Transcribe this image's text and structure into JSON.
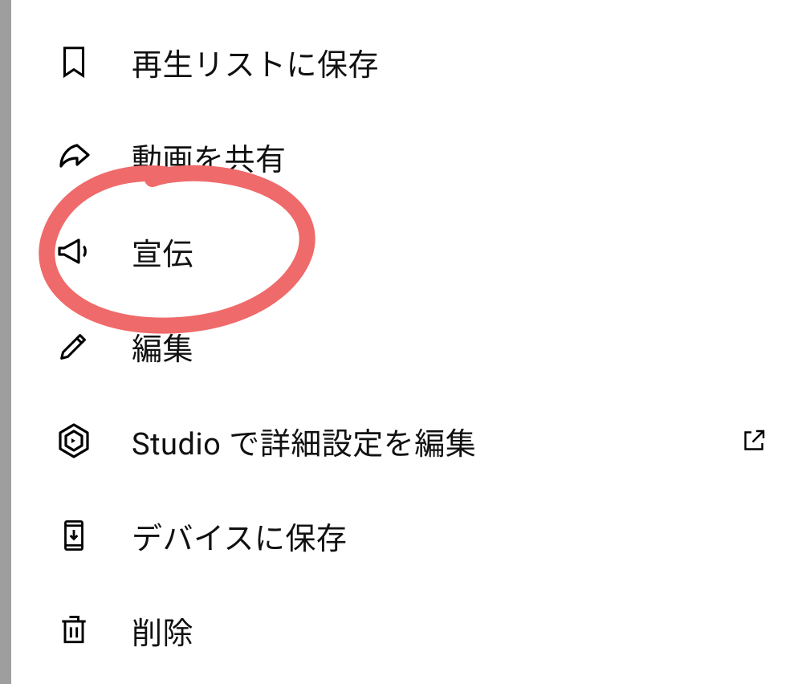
{
  "menu": {
    "items": [
      {
        "id": "save-playlist",
        "icon": "bookmark-icon",
        "label": "再生リストに保存"
      },
      {
        "id": "share-video",
        "icon": "share-icon",
        "label": "動画を共有"
      },
      {
        "id": "promote",
        "icon": "megaphone-icon",
        "label": "宣伝"
      },
      {
        "id": "edit",
        "icon": "pencil-icon",
        "label": "編集"
      },
      {
        "id": "studio-edit",
        "icon": "studio-icon",
        "label": "Studio で詳細設定を編集",
        "external": true
      },
      {
        "id": "save-device",
        "icon": "download-device-icon",
        "label": "デバイスに保存"
      },
      {
        "id": "delete",
        "icon": "trash-icon",
        "label": "削除"
      }
    ]
  },
  "annotation": {
    "color": "#ef6a6a",
    "target": "promote"
  }
}
